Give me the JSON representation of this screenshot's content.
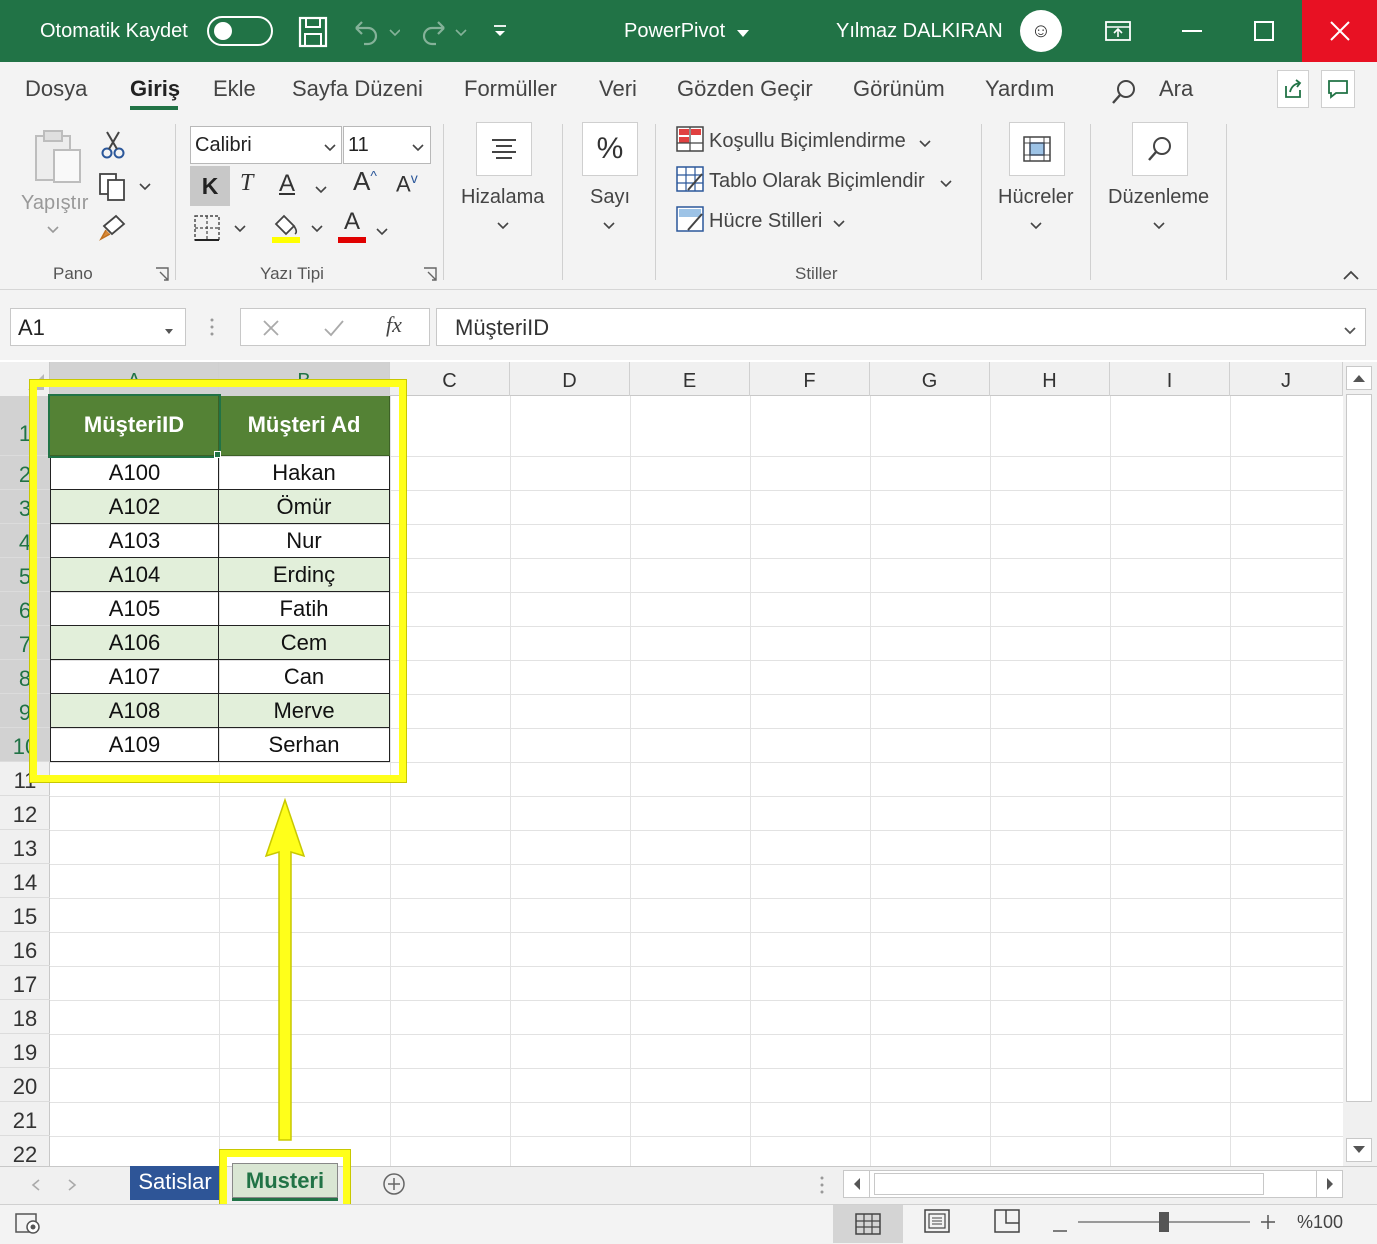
{
  "titlebar": {
    "autosave_label": "Otomatik Kaydet",
    "doc_title": "PowerPivot",
    "user_name": "Yılmaz DALKIRAN",
    "avatar_text": "☺"
  },
  "menu": {
    "tabs": [
      "Dosya",
      "Giriş",
      "Ekle",
      "Sayfa Düzeni",
      "Formüller",
      "Veri",
      "Gözden Geçir",
      "Görünüm",
      "Yardım"
    ],
    "active": "Giriş",
    "search_label": "Ara"
  },
  "ribbon": {
    "paste_label": "Yapıştır",
    "clipboard_group": "Pano",
    "font_name": "Calibri",
    "font_size": "11",
    "bold_label": "K",
    "italic_label": "T",
    "underline_label": "A",
    "grow_label": "A",
    "shrink_label": "A",
    "font_color_label": "A",
    "font_group": "Yazı Tipi",
    "alignment_label": "Hizalama",
    "number_label": "Sayı",
    "number_icon": "%",
    "conditional_label": "Koşullu Biçimlendirme",
    "table_format_label": "Tablo Olarak Biçimlendir",
    "cell_styles_label": "Hücre Stilleri",
    "styles_group": "Stiller",
    "cells_label": "Hücreler",
    "editing_label": "Düzenleme"
  },
  "formula_bar": {
    "name_box": "A1",
    "fx_label": "fx",
    "content": "MüşteriID"
  },
  "columns": [
    "A",
    "B",
    "C",
    "D",
    "E",
    "F",
    "G",
    "H",
    "I",
    "J"
  ],
  "rows": [
    "1",
    "2",
    "3",
    "4",
    "5",
    "6",
    "7",
    "8",
    "9",
    "10",
    "11",
    "12",
    "13",
    "14",
    "15",
    "16",
    "17",
    "18",
    "19",
    "20",
    "21",
    "22"
  ],
  "table": {
    "headers": [
      "MüşteriID",
      "Müşteri Ad"
    ],
    "rows": [
      [
        "A100",
        "Hakan"
      ],
      [
        "A102",
        "Ömür"
      ],
      [
        "A103",
        "Nur"
      ],
      [
        "A104",
        "Erdinç"
      ],
      [
        "A105",
        "Fatih"
      ],
      [
        "A106",
        "Cem"
      ],
      [
        "A107",
        "Can"
      ],
      [
        "A108",
        "Merve"
      ],
      [
        "A109",
        "Serhan"
      ]
    ]
  },
  "sheets": {
    "tab1": "Satislar",
    "tab2": "Musteri",
    "active": "Musteri"
  },
  "status": {
    "zoom": "%100",
    "zoom_level": 1.0
  },
  "colors": {
    "excel_green": "#217346",
    "table_header": "#548235",
    "table_stripe": "#e2efda",
    "highlight": "#ffff1a"
  }
}
